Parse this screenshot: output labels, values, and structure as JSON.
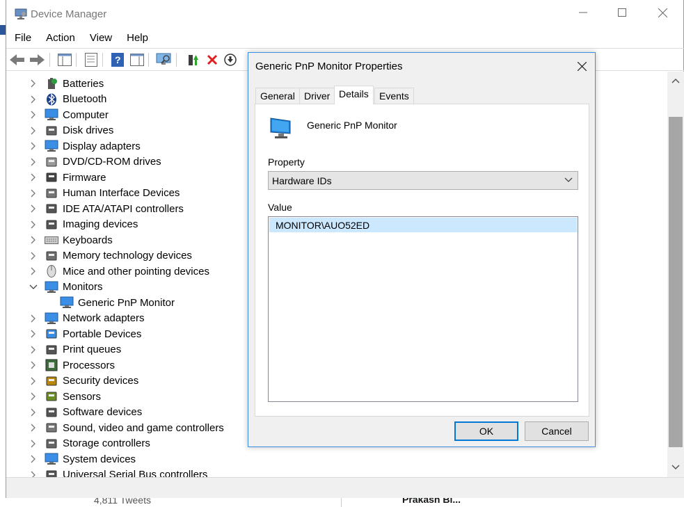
{
  "window": {
    "title": "Device Manager"
  },
  "menu": [
    "File",
    "Action",
    "View",
    "Help"
  ],
  "tree": [
    {
      "label": "Batteries",
      "expanded": false,
      "icon": "battery-icon"
    },
    {
      "label": "Bluetooth",
      "expanded": false,
      "icon": "bluetooth-icon"
    },
    {
      "label": "Computer",
      "expanded": false,
      "icon": "computer-icon"
    },
    {
      "label": "Disk drives",
      "expanded": false,
      "icon": "disk-drive-icon"
    },
    {
      "label": "Display adapters",
      "expanded": false,
      "icon": "display-adapter-icon"
    },
    {
      "label": "DVD/CD-ROM drives",
      "expanded": false,
      "icon": "dvd-drive-icon"
    },
    {
      "label": "Firmware",
      "expanded": false,
      "icon": "firmware-icon"
    },
    {
      "label": "Human Interface Devices",
      "expanded": false,
      "icon": "hid-icon"
    },
    {
      "label": "IDE ATA/ATAPI controllers",
      "expanded": false,
      "icon": "ide-controller-icon"
    },
    {
      "label": "Imaging devices",
      "expanded": false,
      "icon": "camera-icon"
    },
    {
      "label": "Keyboards",
      "expanded": false,
      "icon": "keyboard-icon"
    },
    {
      "label": "Memory technology devices",
      "expanded": false,
      "icon": "memory-icon"
    },
    {
      "label": "Mice and other pointing devices",
      "expanded": false,
      "icon": "mouse-icon"
    },
    {
      "label": "Monitors",
      "expanded": true,
      "icon": "monitor-icon"
    },
    {
      "label": "Generic PnP Monitor",
      "child": true,
      "icon": "monitor-icon"
    },
    {
      "label": "Network adapters",
      "expanded": false,
      "icon": "network-adapter-icon"
    },
    {
      "label": "Portable Devices",
      "expanded": false,
      "icon": "portable-device-icon"
    },
    {
      "label": "Print queues",
      "expanded": false,
      "icon": "printer-icon"
    },
    {
      "label": "Processors",
      "expanded": false,
      "icon": "processor-icon"
    },
    {
      "label": "Security devices",
      "expanded": false,
      "icon": "security-device-icon"
    },
    {
      "label": "Sensors",
      "expanded": false,
      "icon": "sensor-icon"
    },
    {
      "label": "Software devices",
      "expanded": false,
      "icon": "software-device-icon"
    },
    {
      "label": "Sound, video and game controllers",
      "expanded": false,
      "icon": "speaker-icon"
    },
    {
      "label": "Storage controllers",
      "expanded": false,
      "icon": "storage-controller-icon"
    },
    {
      "label": "System devices",
      "expanded": false,
      "icon": "system-device-icon"
    },
    {
      "label": "Universal Serial Bus controllers",
      "expanded": false,
      "icon": "usb-icon"
    }
  ],
  "dialog": {
    "title": "Generic PnP Monitor Properties",
    "tabs": [
      "General",
      "Driver",
      "Details",
      "Events"
    ],
    "active_tab": "Details",
    "device_name": "Generic PnP Monitor",
    "property_label": "Property",
    "property_value": "Hardware IDs",
    "value_label": "Value",
    "values": [
      "MONITOR\\AUO52ED"
    ],
    "ok_label": "OK",
    "cancel_label": "Cancel"
  },
  "background": {
    "tweets_text": "4,811 Tweets",
    "handle_text": "Prakash Bi..."
  },
  "colors": {
    "accent": "#0078d7",
    "selection": "#cce8ff",
    "dialog_border": "#3a8ee6"
  }
}
